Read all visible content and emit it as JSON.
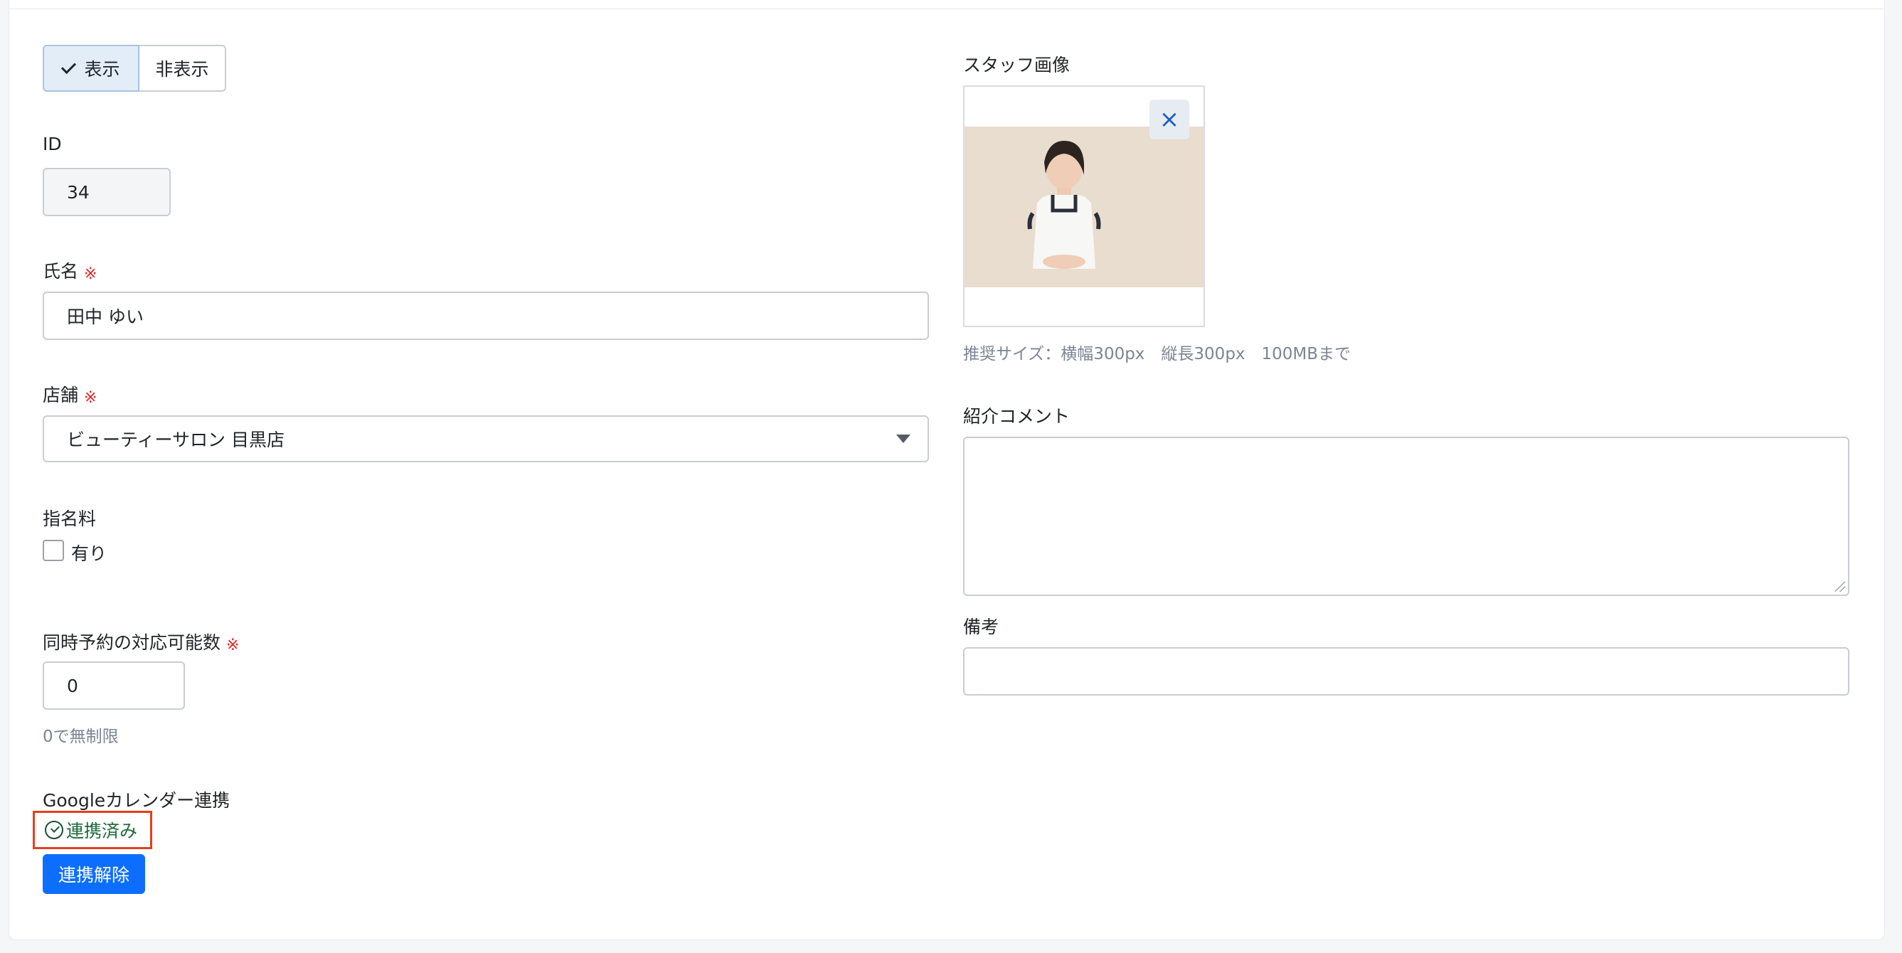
{
  "visibility": {
    "show_label": "表示",
    "hide_label": "非表示",
    "selected": "表示"
  },
  "fields": {
    "id": {
      "label": "ID",
      "value": "34"
    },
    "name": {
      "label": "氏名",
      "required_mark": "※",
      "value": "田中 ゆい"
    },
    "store": {
      "label": "店舗",
      "required_mark": "※",
      "value": "ビューティーサロン 目黒店"
    },
    "nomination_fee": {
      "label": "指名料",
      "checkbox_label": "有り",
      "checked": false
    },
    "concurrent": {
      "label": "同時予約の対応可能数",
      "required_mark": "※",
      "value": "0",
      "help": "0で無制限"
    },
    "google": {
      "label": "Googleカレンダー連携",
      "status": "連携済み",
      "unlink_button": "連携解除"
    },
    "staff_image": {
      "label": "スタッフ画像",
      "close_icon": "close-icon",
      "help": "推奨サイズ：横幅300px　縦長300px　100MBまで"
    },
    "intro": {
      "label": "紹介コメント",
      "value": ""
    },
    "note": {
      "label": "備考",
      "value": ""
    }
  },
  "colors": {
    "primary": "#0d6efd",
    "required": "#e02424",
    "linked": "#1d6b3a",
    "highlight_border": "#e2401c"
  }
}
